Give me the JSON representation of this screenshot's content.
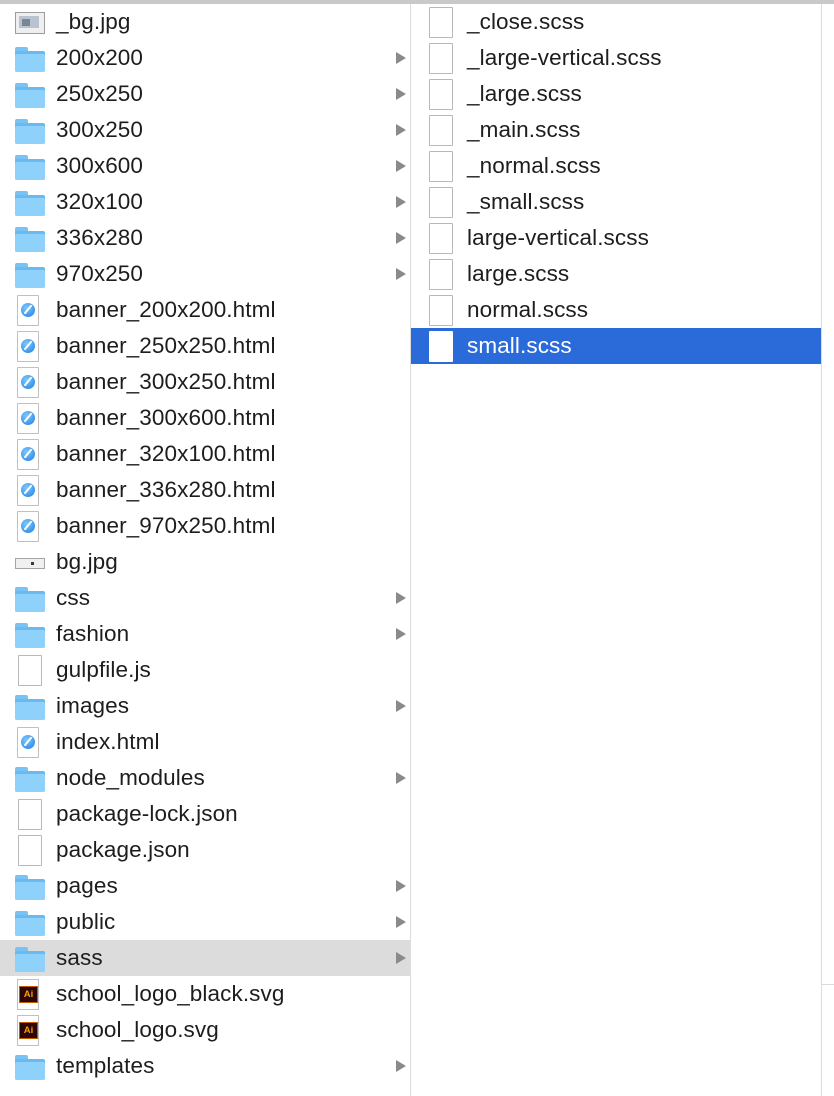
{
  "column1": {
    "items": [
      {
        "label": "_bg.jpg",
        "icon": "image-file-icon",
        "has_children": false,
        "selected": false
      },
      {
        "label": "200x200",
        "icon": "folder-icon",
        "has_children": true,
        "selected": false
      },
      {
        "label": "250x250",
        "icon": "folder-icon",
        "has_children": true,
        "selected": false
      },
      {
        "label": "300x250",
        "icon": "folder-icon",
        "has_children": true,
        "selected": false
      },
      {
        "label": "300x600",
        "icon": "folder-icon",
        "has_children": true,
        "selected": false
      },
      {
        "label": "320x100",
        "icon": "folder-icon",
        "has_children": true,
        "selected": false
      },
      {
        "label": "336x280",
        "icon": "folder-icon",
        "has_children": true,
        "selected": false
      },
      {
        "label": "970x250",
        "icon": "folder-icon",
        "has_children": true,
        "selected": false
      },
      {
        "label": "banner_200x200.html",
        "icon": "html-file-icon",
        "has_children": false,
        "selected": false
      },
      {
        "label": "banner_250x250.html",
        "icon": "html-file-icon",
        "has_children": false,
        "selected": false
      },
      {
        "label": "banner_300x250.html",
        "icon": "html-file-icon",
        "has_children": false,
        "selected": false
      },
      {
        "label": "banner_300x600.html",
        "icon": "html-file-icon",
        "has_children": false,
        "selected": false
      },
      {
        "label": "banner_320x100.html",
        "icon": "html-file-icon",
        "has_children": false,
        "selected": false
      },
      {
        "label": "banner_336x280.html",
        "icon": "html-file-icon",
        "has_children": false,
        "selected": false
      },
      {
        "label": "banner_970x250.html",
        "icon": "html-file-icon",
        "has_children": false,
        "selected": false
      },
      {
        "label": "bg.jpg",
        "icon": "image-strip-file-icon",
        "has_children": false,
        "selected": false
      },
      {
        "label": "css",
        "icon": "folder-icon",
        "has_children": true,
        "selected": false
      },
      {
        "label": "fashion",
        "icon": "folder-icon",
        "has_children": true,
        "selected": false
      },
      {
        "label": "gulpfile.js",
        "icon": "document-icon",
        "has_children": false,
        "selected": false
      },
      {
        "label": "images",
        "icon": "folder-icon",
        "has_children": true,
        "selected": false
      },
      {
        "label": "index.html",
        "icon": "html-file-icon",
        "has_children": false,
        "selected": false
      },
      {
        "label": "node_modules",
        "icon": "folder-icon",
        "has_children": true,
        "selected": false
      },
      {
        "label": "package-lock.json",
        "icon": "document-icon",
        "has_children": false,
        "selected": false
      },
      {
        "label": "package.json",
        "icon": "document-icon",
        "has_children": false,
        "selected": false
      },
      {
        "label": "pages",
        "icon": "folder-icon",
        "has_children": true,
        "selected": false
      },
      {
        "label": "public",
        "icon": "folder-icon",
        "has_children": true,
        "selected": false
      },
      {
        "label": "sass",
        "icon": "folder-icon",
        "has_children": true,
        "selected": "inactive"
      },
      {
        "label": "school_logo_black.svg",
        "icon": "illustrator-file-icon",
        "has_children": false,
        "selected": false
      },
      {
        "label": "school_logo.svg",
        "icon": "illustrator-file-icon",
        "has_children": false,
        "selected": false
      },
      {
        "label": "templates",
        "icon": "folder-icon",
        "has_children": true,
        "selected": false
      }
    ]
  },
  "column2": {
    "items": [
      {
        "label": "_close.scss",
        "icon": "document-icon",
        "selected": false
      },
      {
        "label": "_large-vertical.scss",
        "icon": "document-icon",
        "selected": false
      },
      {
        "label": "_large.scss",
        "icon": "document-icon",
        "selected": false
      },
      {
        "label": "_main.scss",
        "icon": "document-icon",
        "selected": false
      },
      {
        "label": "_normal.scss",
        "icon": "document-icon",
        "selected": false
      },
      {
        "label": "_small.scss",
        "icon": "document-icon",
        "selected": false
      },
      {
        "label": "large-vertical.scss",
        "icon": "document-icon",
        "selected": false
      },
      {
        "label": "large.scss",
        "icon": "document-icon",
        "selected": false
      },
      {
        "label": "normal.scss",
        "icon": "document-icon",
        "selected": false
      },
      {
        "label": "small.scss",
        "icon": "document-icon",
        "selected": "active"
      }
    ]
  },
  "ai_badge_text": "Ai",
  "colors": {
    "selection_active": "#2b6ad9",
    "selection_inactive": "#dcdcdc",
    "folder": "#8ed1fb"
  }
}
